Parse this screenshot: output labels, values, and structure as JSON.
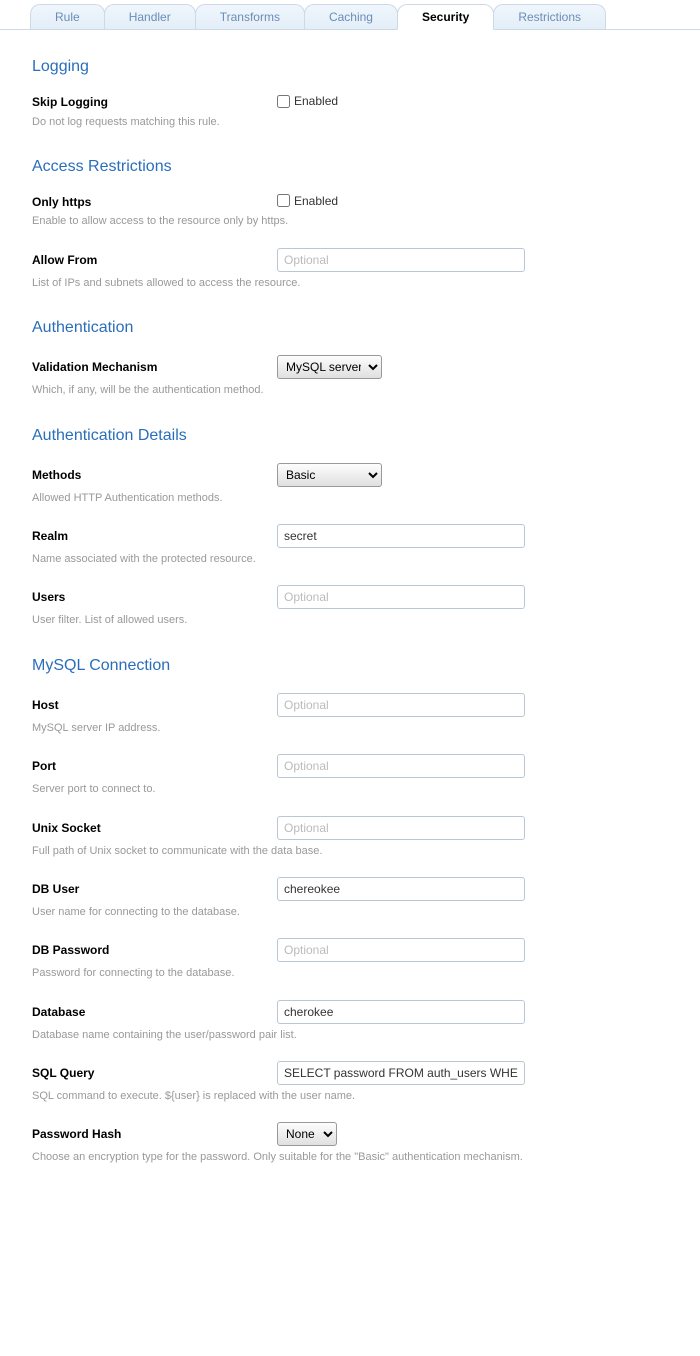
{
  "tabs": {
    "rule": "Rule",
    "handler": "Handler",
    "transforms": "Transforms",
    "caching": "Caching",
    "security": "Security",
    "restrictions": "Restrictions"
  },
  "sections": {
    "logging": "Logging",
    "access_restrictions": "Access Restrictions",
    "authentication": "Authentication",
    "auth_details": "Authentication Details",
    "mysql_connection": "MySQL Connection"
  },
  "fields": {
    "skip_logging": {
      "label": "Skip Logging",
      "desc": "Do not log requests matching this rule.",
      "enabled_label": "Enabled"
    },
    "only_https": {
      "label": "Only https",
      "desc": "Enable to allow access to the resource only by https.",
      "enabled_label": "Enabled"
    },
    "allow_from": {
      "label": "Allow From",
      "desc": "List of IPs and subnets allowed to access the resource.",
      "placeholder": "Optional",
      "value": ""
    },
    "validation": {
      "label": "Validation Mechanism",
      "desc": "Which, if any, will be the authentication method.",
      "value": "MySQL server"
    },
    "methods": {
      "label": "Methods",
      "desc": "Allowed HTTP Authentication methods.",
      "value": "Basic"
    },
    "realm": {
      "label": "Realm",
      "desc": "Name associated with the protected resource.",
      "value": "secret"
    },
    "users": {
      "label": "Users",
      "desc": "User filter. List of allowed users.",
      "placeholder": "Optional",
      "value": ""
    },
    "host": {
      "label": "Host",
      "desc": "MySQL server IP address.",
      "placeholder": "Optional",
      "value": ""
    },
    "port": {
      "label": "Port",
      "desc": "Server port to connect to.",
      "placeholder": "Optional",
      "value": ""
    },
    "unix_socket": {
      "label": "Unix Socket",
      "desc": "Full path of Unix socket to communicate with the data base.",
      "placeholder": "Optional",
      "value": ""
    },
    "db_user": {
      "label": "DB User",
      "desc": "User name for connecting to the database.",
      "value": "chereokee"
    },
    "db_password": {
      "label": "DB Password",
      "desc": "Password for connecting to the database.",
      "placeholder": "Optional",
      "value": ""
    },
    "database": {
      "label": "Database",
      "desc": "Database name containing the user/password pair list.",
      "value": "cherokee"
    },
    "sql_query": {
      "label": "SQL Query",
      "desc": "SQL command to execute. ${user} is replaced with the user name.",
      "value": "SELECT password FROM auth_users WHERE username = '${user}'"
    },
    "password_hash": {
      "label": "Password Hash",
      "desc": "Choose an encryption type for the password. Only suitable for the \"Basic\" authentication mechanism.",
      "value": "None"
    }
  }
}
